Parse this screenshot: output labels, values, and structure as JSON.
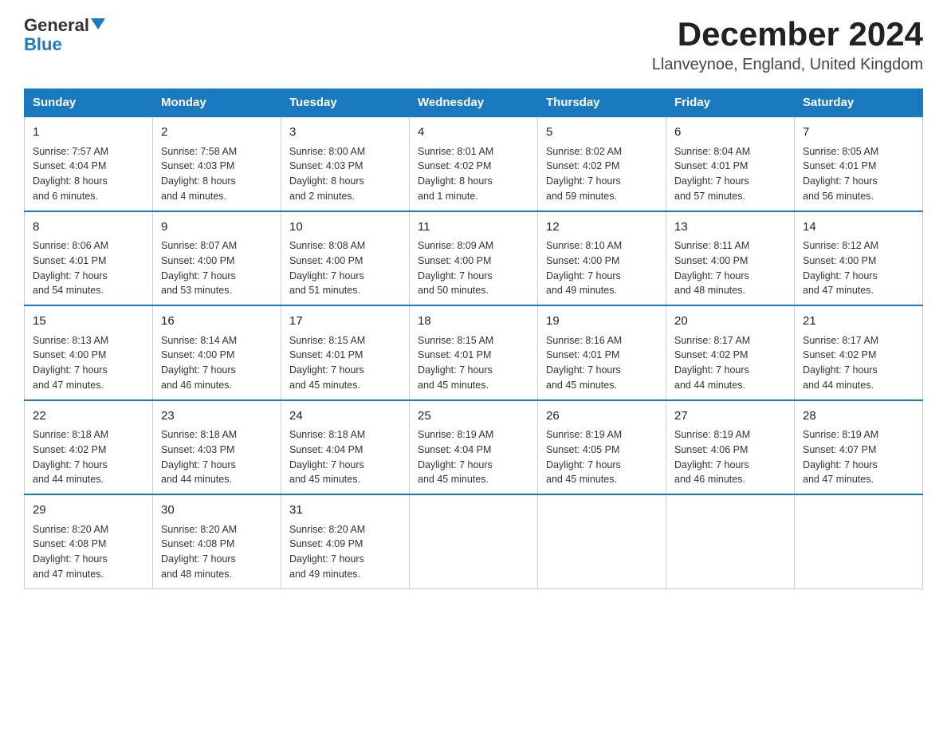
{
  "header": {
    "logo_general": "General",
    "logo_blue": "Blue",
    "title": "December 2024",
    "subtitle": "Llanveynoe, England, United Kingdom"
  },
  "days_of_week": [
    "Sunday",
    "Monday",
    "Tuesday",
    "Wednesday",
    "Thursday",
    "Friday",
    "Saturday"
  ],
  "weeks": [
    [
      {
        "day": "1",
        "info": "Sunrise: 7:57 AM\nSunset: 4:04 PM\nDaylight: 8 hours\nand 6 minutes."
      },
      {
        "day": "2",
        "info": "Sunrise: 7:58 AM\nSunset: 4:03 PM\nDaylight: 8 hours\nand 4 minutes."
      },
      {
        "day": "3",
        "info": "Sunrise: 8:00 AM\nSunset: 4:03 PM\nDaylight: 8 hours\nand 2 minutes."
      },
      {
        "day": "4",
        "info": "Sunrise: 8:01 AM\nSunset: 4:02 PM\nDaylight: 8 hours\nand 1 minute."
      },
      {
        "day": "5",
        "info": "Sunrise: 8:02 AM\nSunset: 4:02 PM\nDaylight: 7 hours\nand 59 minutes."
      },
      {
        "day": "6",
        "info": "Sunrise: 8:04 AM\nSunset: 4:01 PM\nDaylight: 7 hours\nand 57 minutes."
      },
      {
        "day": "7",
        "info": "Sunrise: 8:05 AM\nSunset: 4:01 PM\nDaylight: 7 hours\nand 56 minutes."
      }
    ],
    [
      {
        "day": "8",
        "info": "Sunrise: 8:06 AM\nSunset: 4:01 PM\nDaylight: 7 hours\nand 54 minutes."
      },
      {
        "day": "9",
        "info": "Sunrise: 8:07 AM\nSunset: 4:00 PM\nDaylight: 7 hours\nand 53 minutes."
      },
      {
        "day": "10",
        "info": "Sunrise: 8:08 AM\nSunset: 4:00 PM\nDaylight: 7 hours\nand 51 minutes."
      },
      {
        "day": "11",
        "info": "Sunrise: 8:09 AM\nSunset: 4:00 PM\nDaylight: 7 hours\nand 50 minutes."
      },
      {
        "day": "12",
        "info": "Sunrise: 8:10 AM\nSunset: 4:00 PM\nDaylight: 7 hours\nand 49 minutes."
      },
      {
        "day": "13",
        "info": "Sunrise: 8:11 AM\nSunset: 4:00 PM\nDaylight: 7 hours\nand 48 minutes."
      },
      {
        "day": "14",
        "info": "Sunrise: 8:12 AM\nSunset: 4:00 PM\nDaylight: 7 hours\nand 47 minutes."
      }
    ],
    [
      {
        "day": "15",
        "info": "Sunrise: 8:13 AM\nSunset: 4:00 PM\nDaylight: 7 hours\nand 47 minutes."
      },
      {
        "day": "16",
        "info": "Sunrise: 8:14 AM\nSunset: 4:00 PM\nDaylight: 7 hours\nand 46 minutes."
      },
      {
        "day": "17",
        "info": "Sunrise: 8:15 AM\nSunset: 4:01 PM\nDaylight: 7 hours\nand 45 minutes."
      },
      {
        "day": "18",
        "info": "Sunrise: 8:15 AM\nSunset: 4:01 PM\nDaylight: 7 hours\nand 45 minutes."
      },
      {
        "day": "19",
        "info": "Sunrise: 8:16 AM\nSunset: 4:01 PM\nDaylight: 7 hours\nand 45 minutes."
      },
      {
        "day": "20",
        "info": "Sunrise: 8:17 AM\nSunset: 4:02 PM\nDaylight: 7 hours\nand 44 minutes."
      },
      {
        "day": "21",
        "info": "Sunrise: 8:17 AM\nSunset: 4:02 PM\nDaylight: 7 hours\nand 44 minutes."
      }
    ],
    [
      {
        "day": "22",
        "info": "Sunrise: 8:18 AM\nSunset: 4:02 PM\nDaylight: 7 hours\nand 44 minutes."
      },
      {
        "day": "23",
        "info": "Sunrise: 8:18 AM\nSunset: 4:03 PM\nDaylight: 7 hours\nand 44 minutes."
      },
      {
        "day": "24",
        "info": "Sunrise: 8:18 AM\nSunset: 4:04 PM\nDaylight: 7 hours\nand 45 minutes."
      },
      {
        "day": "25",
        "info": "Sunrise: 8:19 AM\nSunset: 4:04 PM\nDaylight: 7 hours\nand 45 minutes."
      },
      {
        "day": "26",
        "info": "Sunrise: 8:19 AM\nSunset: 4:05 PM\nDaylight: 7 hours\nand 45 minutes."
      },
      {
        "day": "27",
        "info": "Sunrise: 8:19 AM\nSunset: 4:06 PM\nDaylight: 7 hours\nand 46 minutes."
      },
      {
        "day": "28",
        "info": "Sunrise: 8:19 AM\nSunset: 4:07 PM\nDaylight: 7 hours\nand 47 minutes."
      }
    ],
    [
      {
        "day": "29",
        "info": "Sunrise: 8:20 AM\nSunset: 4:08 PM\nDaylight: 7 hours\nand 47 minutes."
      },
      {
        "day": "30",
        "info": "Sunrise: 8:20 AM\nSunset: 4:08 PM\nDaylight: 7 hours\nand 48 minutes."
      },
      {
        "day": "31",
        "info": "Sunrise: 8:20 AM\nSunset: 4:09 PM\nDaylight: 7 hours\nand 49 minutes."
      },
      null,
      null,
      null,
      null
    ]
  ]
}
